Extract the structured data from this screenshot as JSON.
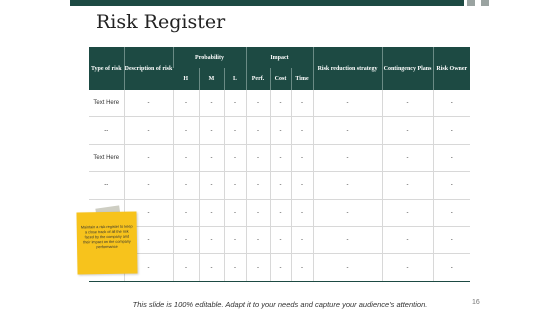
{
  "title": "Risk Register",
  "table": {
    "h_type": "Type of risk",
    "h_desc": "Description of risk",
    "h_prob": "Probability",
    "h_impact": "Impact",
    "h_reduction": "Risk reduction strategy",
    "h_contingency": "Contingency Plans",
    "h_owner": "Risk Owner",
    "sub": [
      "H",
      "M",
      "L",
      "Perf.",
      "Cost",
      "Time"
    ],
    "rows": [
      [
        "Text Here",
        "-",
        "-",
        "-",
        "-",
        "-",
        "-",
        "-",
        "-",
        "-",
        "-"
      ],
      [
        "--",
        "-",
        "-",
        "-",
        "-",
        "-",
        "-",
        "-",
        "-",
        "-",
        "-"
      ],
      [
        "Text Here",
        "-",
        "-",
        "-",
        "-",
        "-",
        "-",
        "-",
        "-",
        "-",
        "-"
      ],
      [
        "--",
        "-",
        "-",
        "-",
        "-",
        "-",
        "-",
        "-",
        "-",
        "-",
        "-"
      ],
      [
        "",
        "-",
        "-",
        "-",
        "-",
        "-",
        "-",
        "-",
        "-",
        "-",
        "-"
      ],
      [
        "",
        "-",
        "-",
        "-",
        "-",
        "-",
        "-",
        "-",
        "-",
        "-",
        "-"
      ],
      [
        "",
        "-",
        "-",
        "-",
        "-",
        "-",
        "-",
        "-",
        "-",
        "-",
        "-"
      ]
    ]
  },
  "note": "Maintain a risk register to keep a close track of all the risk faced by the company and their impact on the company performance",
  "footer": "This slide is 100% editable. Adapt it to your needs and capture your audience's attention.",
  "page_number": "16",
  "colors": {
    "header": "#1d4a43",
    "note": "#f7c31c"
  }
}
